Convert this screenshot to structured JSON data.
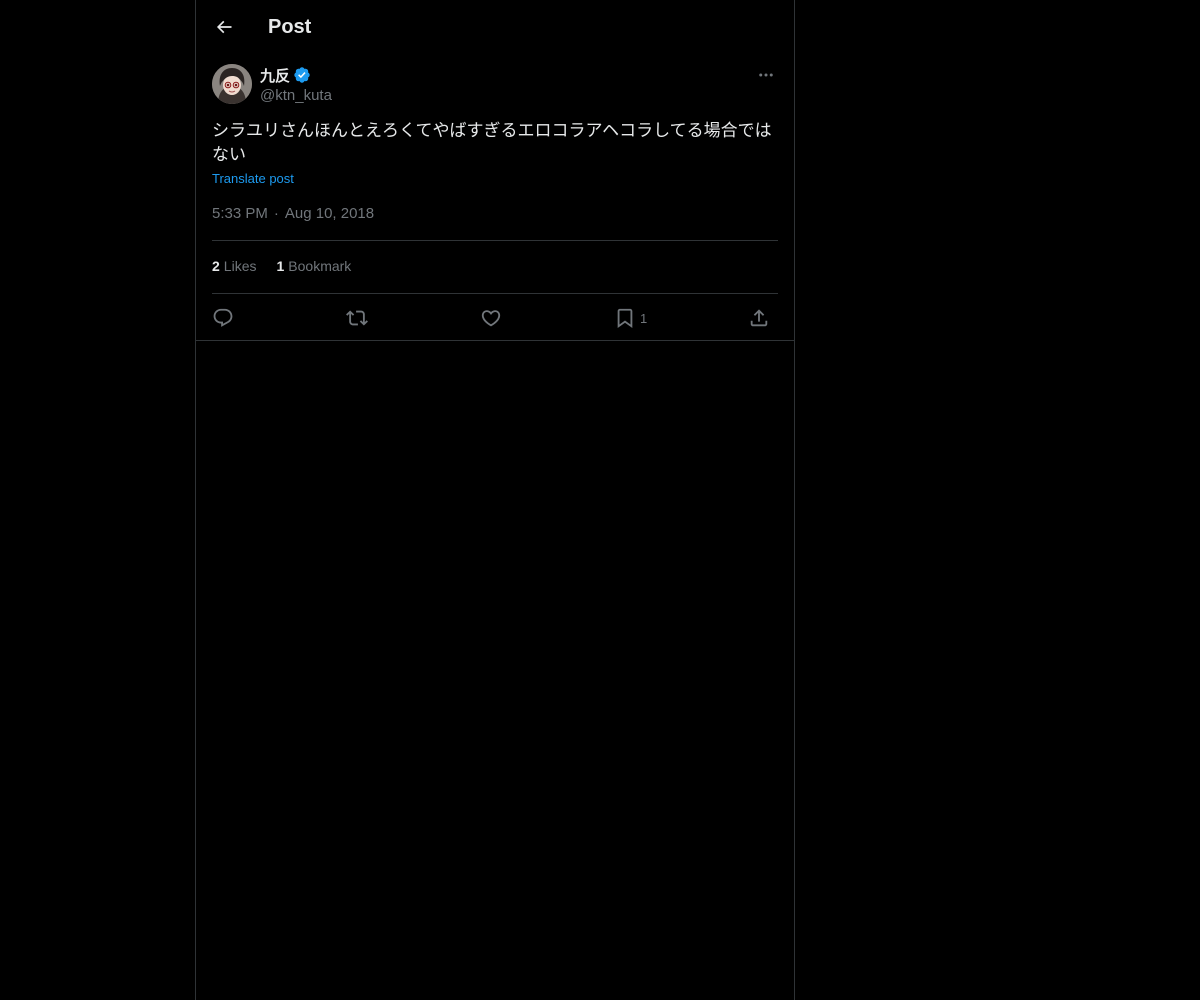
{
  "header": {
    "title": "Post",
    "back_icon": "arrow-left-icon"
  },
  "post": {
    "author": {
      "display_name": "九反",
      "handle": "@ktn_kuta",
      "verified": true
    },
    "text": "シラユリさんほんとえろくてやばすぎるエロコラアヘコラしてる場合ではない",
    "translate_label": "Translate post",
    "time": "5:33 PM",
    "separator": "·",
    "date": "Aug 10, 2018",
    "stats": {
      "likes_count": "2",
      "likes_label": "Likes",
      "bookmarks_count": "1",
      "bookmarks_label": "Bookmark"
    },
    "actions": {
      "reply_icon": "reply-icon",
      "repost_icon": "repost-icon",
      "like_icon": "heart-icon",
      "bookmark_icon": "bookmark-icon",
      "bookmark_count": "1",
      "share_icon": "share-icon"
    }
  },
  "colors": {
    "background": "#000000",
    "text_primary": "#e7e9ea",
    "text_secondary": "#71767b",
    "accent": "#1d9bf0",
    "border": "#2f3336"
  }
}
